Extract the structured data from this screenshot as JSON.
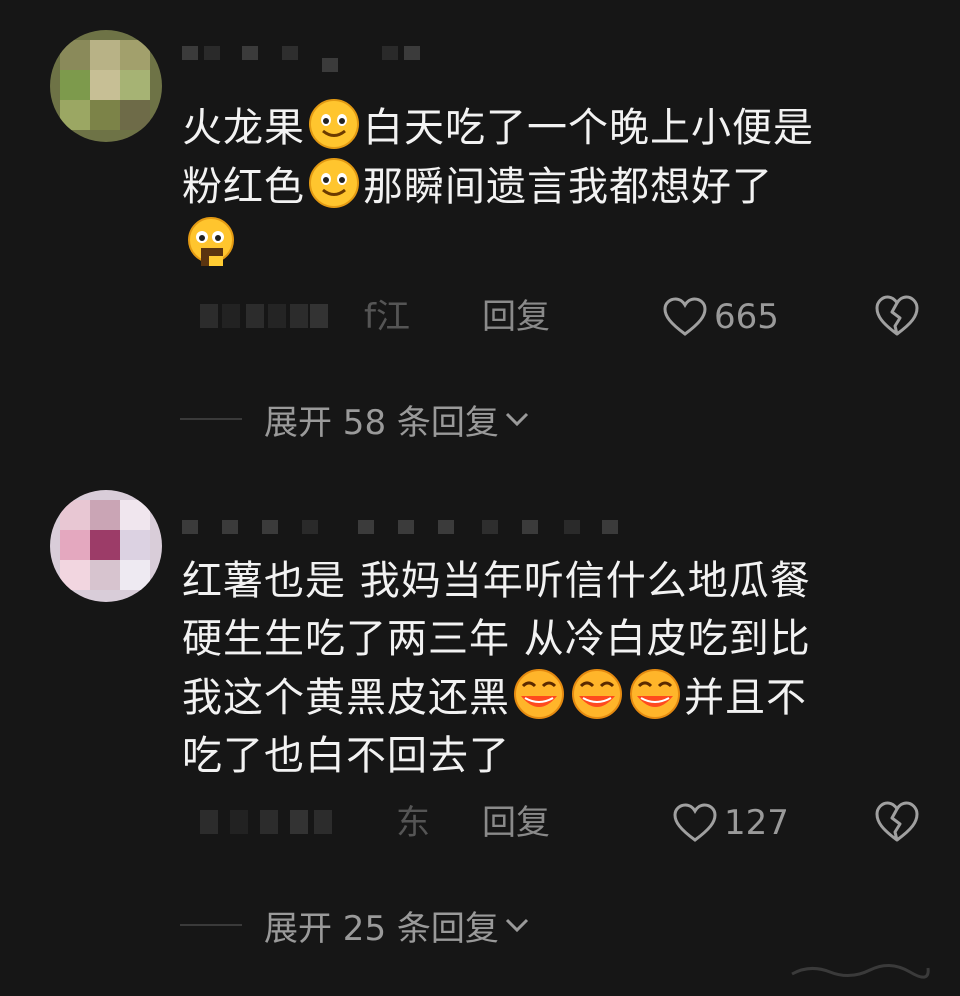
{
  "comments": [
    {
      "text_line1": "火龙果",
      "text_line1b": "白天吃了一个晚上小便是",
      "text_line2": "粉红色",
      "text_line2b": "那瞬间遗言我都想好了",
      "location_fragment": "f江",
      "reply_label": "回复",
      "likes": "665",
      "expand_label": "展开 58 条回复",
      "icons": {
        "like": "heart-outline-icon",
        "dislike": "broken-heart-icon",
        "emoji_smile": "smile-emoji",
        "emoji_surprise": "surprised-emoji"
      }
    },
    {
      "text_line1": "红薯也是 我妈当年听信什么地瓜餐",
      "text_line2": "硬生生吃了两三年 从冷白皮吃到比",
      "text_line3a": "我这个黄黑皮还黑",
      "text_line3b": "并且不",
      "text_line4": "吃了也白不回去了",
      "location_fragment": "东",
      "reply_label": "回复",
      "likes": "127",
      "expand_label": "展开 25 条回复",
      "icons": {
        "like": "heart-outline-icon",
        "dislike": "broken-heart-icon",
        "emoji": "laughing-crying-emoji"
      }
    }
  ],
  "colors": {
    "background": "#161616",
    "text": "#f2f2f2",
    "muted": "#9a9a9a"
  }
}
